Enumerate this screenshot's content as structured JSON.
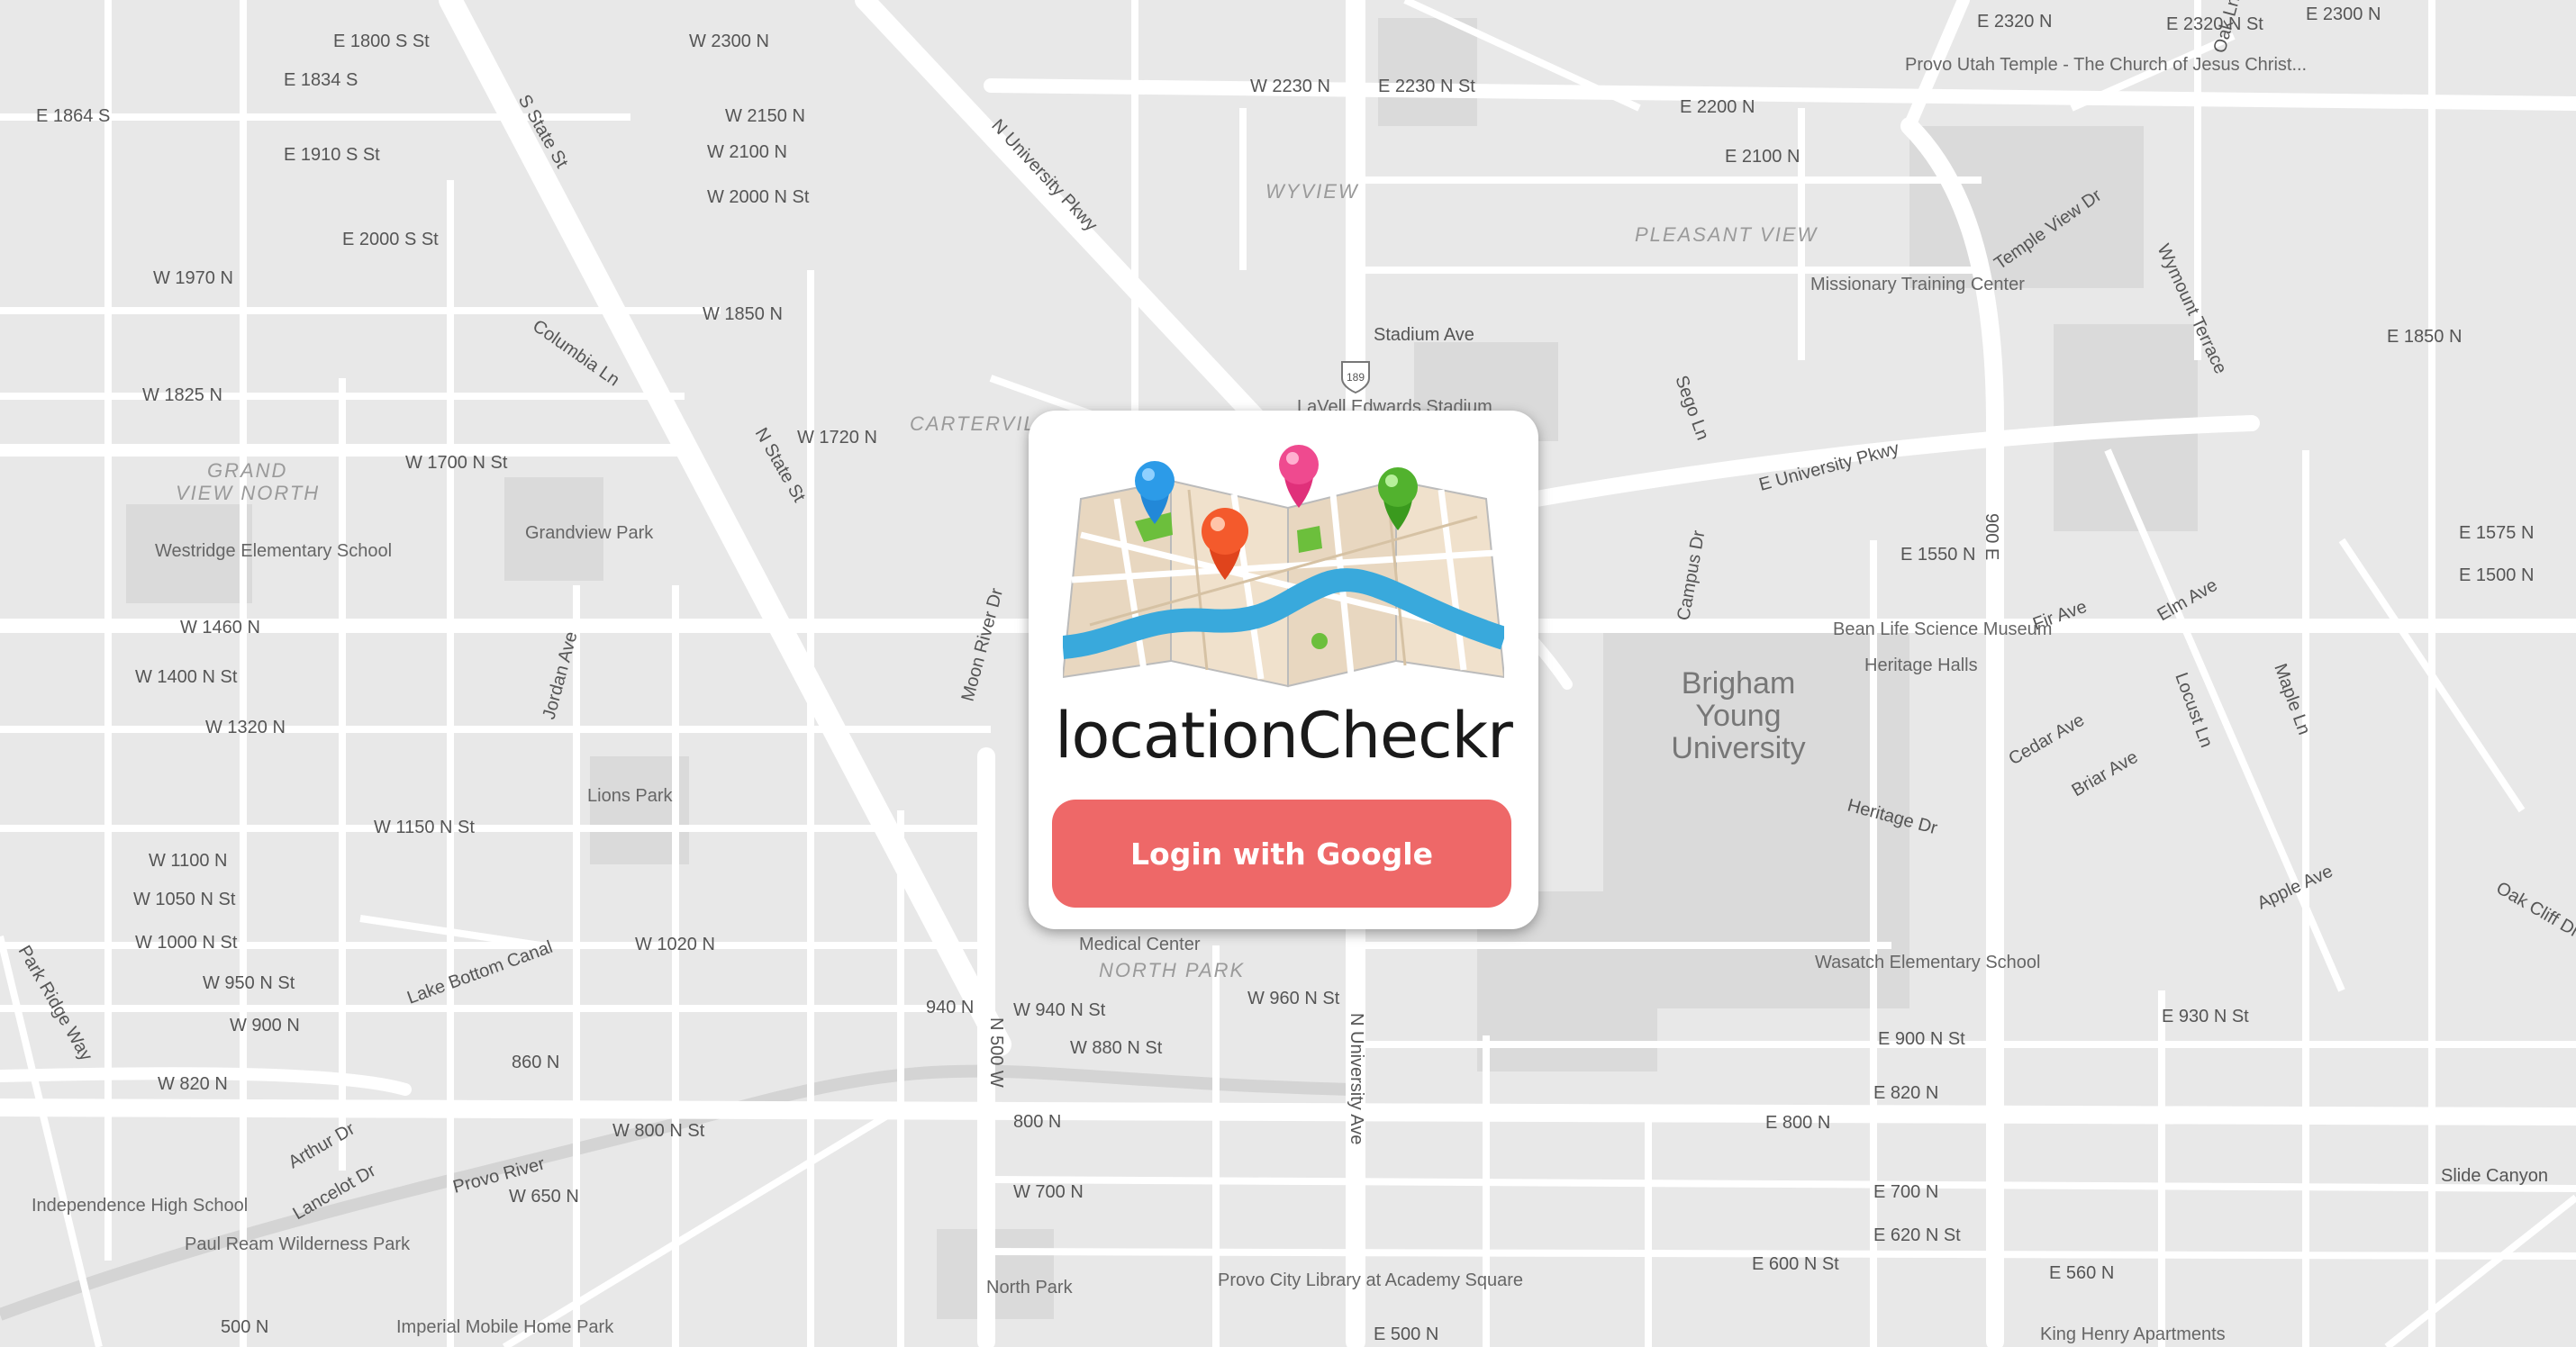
{
  "app": {
    "title": "locationCheckr",
    "login_label": "Login with Google"
  },
  "colors": {
    "button": "#ee6868",
    "map_background": "#e8e8e8",
    "road": "#ffffff"
  },
  "map": {
    "area_labels": [
      "WYVIEW",
      "PLEASANT VIEW",
      "CARTERVILLE",
      "GRAND",
      "VIEW NORTH",
      "NORTH PARK"
    ],
    "university_lines": [
      "Brigham",
      "Young",
      "University"
    ],
    "street_labels": [
      "E 1800 S St",
      "E 1834 S",
      "E 1864 S",
      "E 1910 S St",
      "E 2000 S St",
      "W 2300 N",
      "W 2150 N",
      "W 2100 N",
      "W 2000 N St",
      "W 1850 N",
      "W 1720 N",
      "W 1700 N St",
      "W 1825 N",
      "W 1970 N",
      "W 1460 N",
      "W 1400 N St",
      "W 1320 N",
      "W 1150 N St",
      "W 1100 N",
      "W 1050 N St",
      "W 1000 N St",
      "W 1020 N",
      "W 950 N St",
      "W 900 N",
      "W 820 N",
      "W 800 N St",
      "W 650 N",
      "W 700 N",
      "W 940 N St",
      "W 880 N St",
      "W 960 N St",
      "W 2230 N",
      "E 2230 N St",
      "E 2200 N",
      "E 2100 N",
      "E 2320 N",
      "E 2320 N St",
      "E 2300 N",
      "E 1550 N",
      "E 1575 N",
      "E 1500 N",
      "E 1850 N",
      "E 930 N St",
      "E 900 N St",
      "E 820 N",
      "E 800 N",
      "E 700 N",
      "E 620 N St",
      "E 600 N St",
      "E 560 N",
      "E 500 N",
      "800 N",
      "860 N",
      "500 N",
      "940 N",
      "S State St",
      "N State St",
      "Columbia Ln",
      "N University Pkwy",
      "Provo River",
      "Stadium Ave",
      "E University Pkwy",
      "Temple View Dr",
      "Campus Dr",
      "Heritage Dr",
      "Cedar Ave",
      "Briar Ave",
      "Apple Ave",
      "Elm Ave",
      "Fir Ave",
      "N 500 W",
      "900 E",
      "N University Ave",
      "Moon River Dr",
      "Lake Bottom Canal",
      "Arthur Dr",
      "Lancelot Dr",
      "Park Ridge Way",
      "Jordan Ave",
      "Slide Canyon",
      "Oak Cliff Dr",
      "Oak Ln",
      "Maple Ln",
      "Locust Ln",
      "Wymount Terrace",
      "Sego Ln"
    ],
    "poi_labels": [
      "Provo Utah Temple - The Church of Jesus Christ...",
      "Missionary Training Center",
      "LaVell Edwards Stadium",
      "Westridge Elementary School",
      "Grandview Park",
      "Lions Park",
      "Bean Life Science Museum",
      "Heritage Halls",
      "Wasatch Elementary School",
      "Independence High School",
      "Paul Ream Wilderness Park",
      "Provo City Library at Academy Square",
      "North Park",
      "Imperial Mobile Home Park",
      "King Henry Apartments",
      "Medical Center",
      "Lavell Edwards Stadium"
    ]
  }
}
